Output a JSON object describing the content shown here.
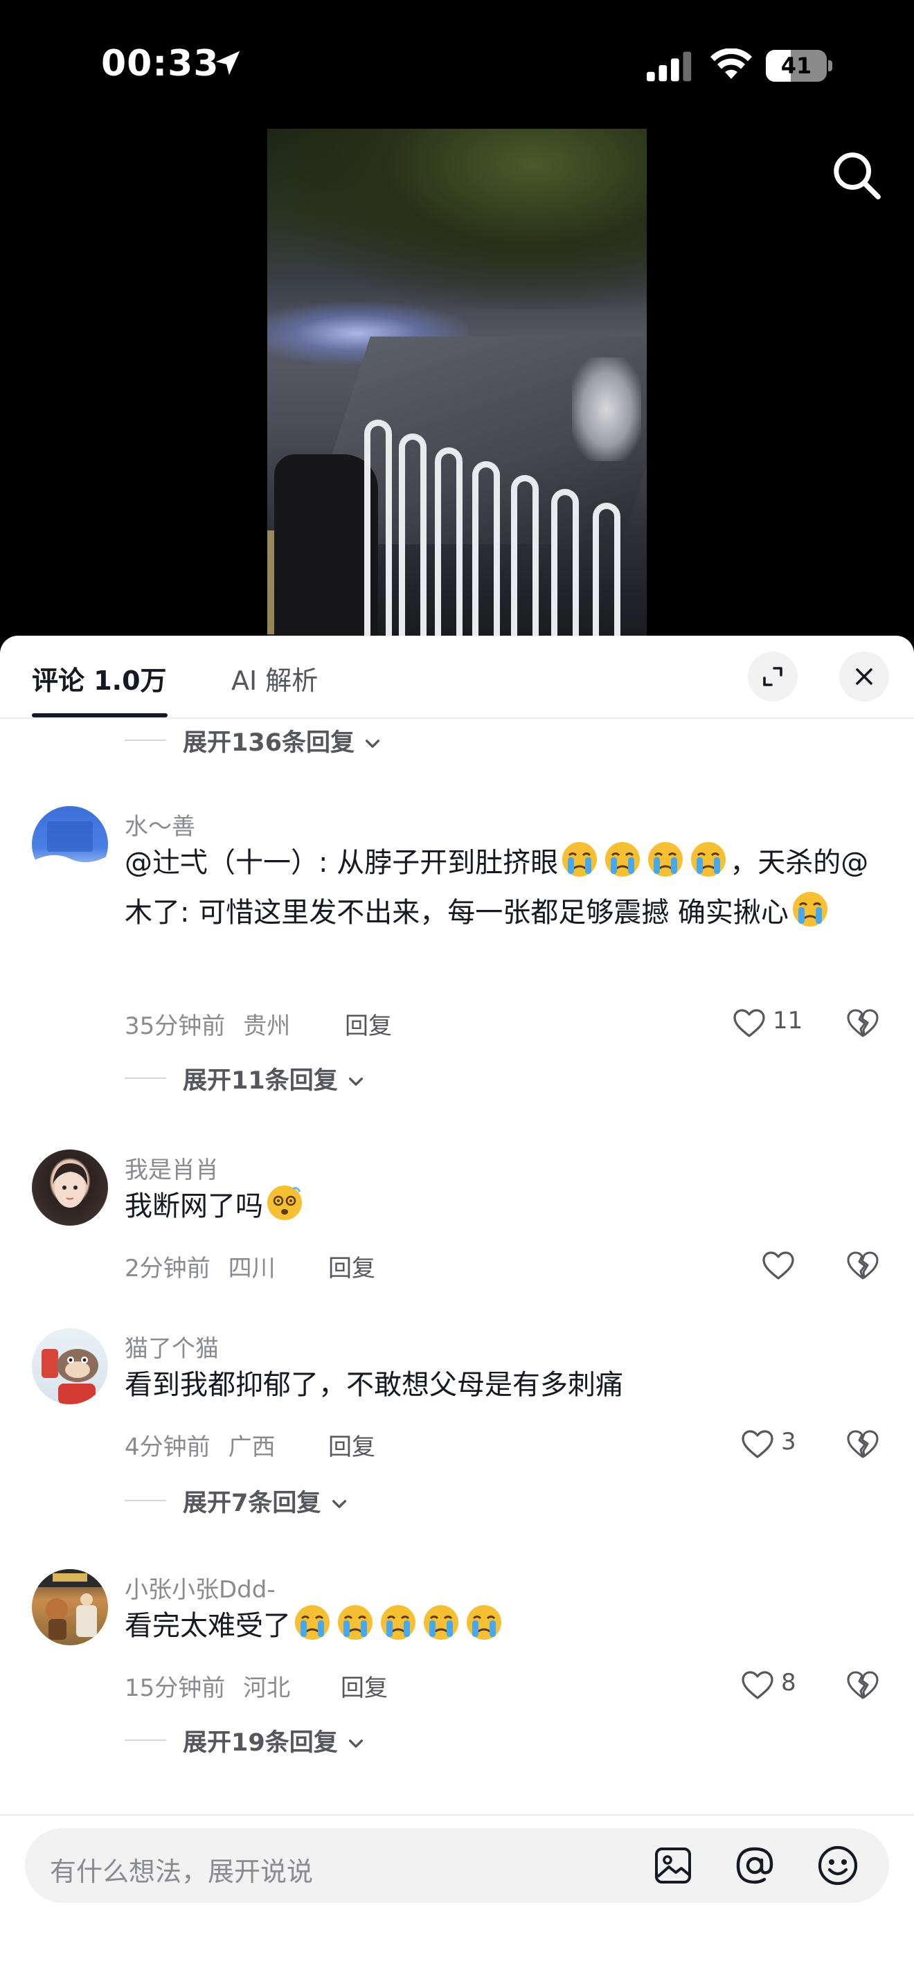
{
  "status_bar": {
    "time": "00:33",
    "battery": "41",
    "battery_level": 0.41
  },
  "tabs": {
    "comments": "评论 1.0万",
    "ai": "AI 解析"
  },
  "top_expand": "展开136条回复",
  "comments": [
    {
      "username": "水～善",
      "text_parts": [
        "@辻弌（十一）: 从脖子开到肚挤眼",
        "，天杀的@木了: 可惜这里发不出来，每一张都足够震撼  确实揪心"
      ],
      "time": "35分钟前",
      "location": "贵州",
      "reply": "回复",
      "likes": "11",
      "expand": "展开11条回复"
    },
    {
      "username": "我是肖肖",
      "text": "我断网了吗",
      "time": "2分钟前",
      "location": "四川",
      "reply": "回复"
    },
    {
      "username": "猫了个猫",
      "text": "看到我都抑郁了，不敢想父母是有多刺痛",
      "time": "4分钟前",
      "location": "广西",
      "reply": "回复",
      "likes": "3",
      "expand": "展开7条回复"
    },
    {
      "username": "小张小张Ddd-",
      "text": "看完太难受了",
      "time": "15分钟前",
      "location": "河北",
      "reply": "回复",
      "likes": "8",
      "expand": "展开19条回复"
    }
  ],
  "input": {
    "placeholder": "有什么想法，展开说说"
  },
  "icons": [
    "location-arrow-icon",
    "signal-icon",
    "wifi-icon",
    "battery-icon",
    "search-icon",
    "expand-icon",
    "close-icon",
    "chevron-down-icon",
    "heart-icon",
    "broken-heart-icon",
    "crying-emoji-icon",
    "dizzy-emoji-icon",
    "image-icon",
    "at-icon",
    "emoji-icon"
  ]
}
